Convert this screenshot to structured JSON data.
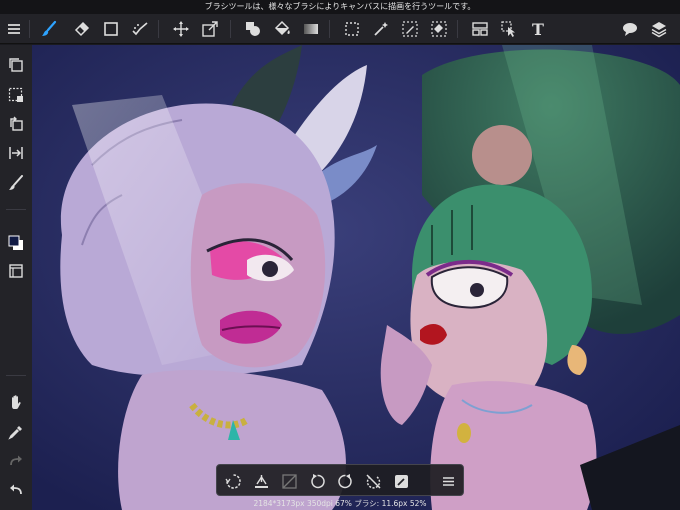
{
  "status_bar": {
    "text": "ブラシツールは、様々なブラシによりキャンバスに描画を行うツールです。"
  },
  "toolbar": {
    "items": [
      "menu-icon",
      "brush-icon",
      "eraser-icon",
      "rectangle-icon",
      "smudge-icon",
      "move-icon",
      "transform-icon",
      "fill-icon",
      "bucket-icon",
      "gradient-icon",
      "lasso-select-icon",
      "magic-wand-icon",
      "select-pen-icon",
      "select-eraser-icon",
      "frame-divider-icon",
      "operation-icon",
      "text-icon",
      "speech-bubble-icon",
      "layers-icon"
    ],
    "text_tool_label": "T"
  },
  "sidebar": {
    "items": [
      "copy-icon",
      "select-all-icon",
      "paste-icon",
      "flip-icon",
      "brush-size-icon",
      "color-swatch-icon",
      "layer-panel-icon",
      "hand-icon",
      "eyedropper-icon",
      "redo-icon",
      "undo-icon"
    ],
    "colors": {
      "foreground": "#101a44",
      "background": "#ffffff"
    }
  },
  "bottom_bar": {
    "items": [
      "deselect-icon",
      "clear-icon",
      "invert-icon",
      "rotate-left-icon",
      "rotate-right-icon",
      "reset-rotation-icon",
      "layer-edit-icon",
      "menu-icon"
    ]
  },
  "canvas_info": {
    "text": "2184*3173px 350dpi 67% ブラシ: 11.6px 52%"
  },
  "colors": {
    "accent": "#2ea3ff",
    "toolbar_bg": "#232328"
  }
}
